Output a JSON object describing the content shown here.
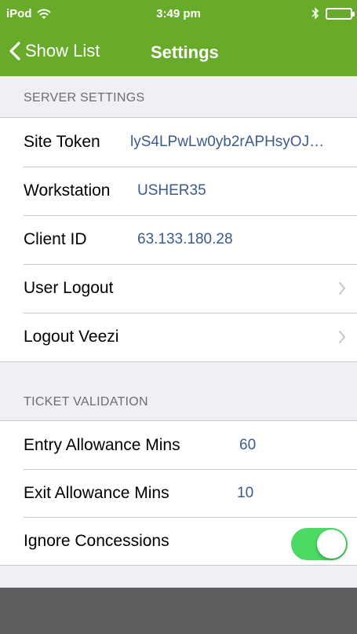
{
  "status_bar": {
    "carrier": "iPod",
    "time": "3:49 pm",
    "icons": [
      "wifi-icon",
      "bluetooth-icon",
      "battery-icon"
    ]
  },
  "nav": {
    "back_label": "Show List",
    "title": "Settings"
  },
  "server_settings": {
    "header": "SERVER SETTINGS",
    "site_token": {
      "label": "Site Token",
      "value": "lyS4LPwLw0yb2rAPHsyOJ…"
    },
    "workstation": {
      "label": "Workstation",
      "value": "USHER35"
    },
    "client_id": {
      "label": "Client ID",
      "value": "63.133.180.28"
    },
    "user_logout": {
      "label": "User Logout"
    },
    "logout_veezi": {
      "label": "Logout Veezi"
    }
  },
  "ticket_validation": {
    "header": "TICKET VALIDATION",
    "entry_allowance": {
      "label": "Entry Allowance Mins",
      "value": "60"
    },
    "exit_allowance": {
      "label": "Exit Allowance Mins",
      "value": "10"
    },
    "ignore_concessions": {
      "label": "Ignore Concessions",
      "enabled": true
    }
  },
  "colors": {
    "nav_bar": "#68ab2b",
    "value_text": "#3b5b8c",
    "toggle_on": "#4cd964",
    "background": "#efeff4",
    "bottom_bar": "#5d5d5f"
  }
}
